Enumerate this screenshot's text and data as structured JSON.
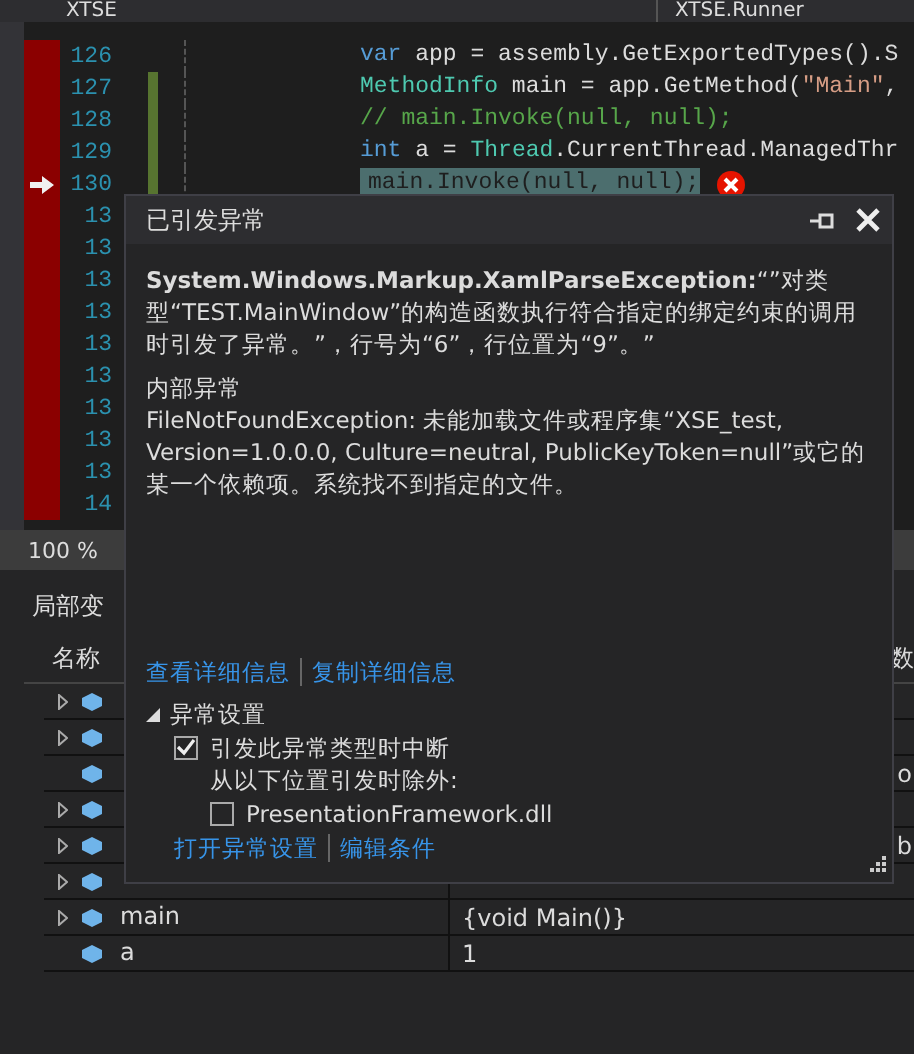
{
  "tabs": [
    {
      "label": "XTSE",
      "kind": "project"
    },
    {
      "label": "XTSE.Runner",
      "kind": "class"
    }
  ],
  "editor": {
    "lines": [
      {
        "number": "126",
        "current": false,
        "error": false,
        "changed": false,
        "tokens": [
          {
            "text": "var",
            "kind": "keyword"
          },
          {
            "text": " app = assembly.GetExportedTypes().S",
            "kind": "plain"
          }
        ]
      },
      {
        "number": "127",
        "current": false,
        "error": false,
        "changed": true,
        "tokens": [
          {
            "text": "MethodInfo",
            "kind": "type"
          },
          {
            "text": " main = app.GetMethod(",
            "kind": "plain"
          },
          {
            "text": "\"Main\"",
            "kind": "string"
          },
          {
            "text": ",",
            "kind": "plain"
          }
        ]
      },
      {
        "number": "128",
        "current": false,
        "error": false,
        "changed": true,
        "tokens": [
          {
            "text": "// main.Invoke(null, null);",
            "kind": "comment"
          }
        ]
      },
      {
        "number": "129",
        "current": false,
        "error": false,
        "changed": true,
        "tokens": [
          {
            "text": "int",
            "kind": "keyword"
          },
          {
            "text": " a = ",
            "kind": "plain"
          },
          {
            "text": "Thread",
            "kind": "type"
          },
          {
            "text": ".CurrentThread.ManagedThr",
            "kind": "plain"
          }
        ]
      },
      {
        "number": "130",
        "current": true,
        "error": true,
        "changed": true,
        "tokens": [
          {
            "text": "main.Invoke(null, null);",
            "kind": "plain"
          }
        ]
      },
      {
        "number": "13"
      },
      {
        "number": "13"
      },
      {
        "number": "13"
      },
      {
        "number": "13"
      },
      {
        "number": "13"
      },
      {
        "number": "13"
      },
      {
        "number": "13"
      },
      {
        "number": "13"
      },
      {
        "number": "13"
      },
      {
        "number": "14"
      }
    ],
    "zoom": "100 %"
  },
  "locals": {
    "title": "局部变",
    "columns": [
      "名称",
      "数"
    ],
    "rows": [
      {
        "expandable": true,
        "name": "",
        "value": ""
      },
      {
        "expandable": true,
        "name": "",
        "value": ""
      },
      {
        "expandable": false,
        "name": "",
        "value": "o"
      },
      {
        "expandable": true,
        "name": "",
        "value": ""
      },
      {
        "expandable": true,
        "name": "",
        "value": "b"
      },
      {
        "expandable": true,
        "name": "",
        "value": ""
      },
      {
        "expandable": true,
        "name": "main",
        "value": "{void Main()}"
      },
      {
        "expandable": false,
        "name": "a",
        "value": "1"
      }
    ]
  },
  "popup": {
    "title": "已引发异常",
    "message": "**System.Windows.Markup.XamlParseException:**“”对类型“TEST.MainWindow”的构造函数执行符合指定的绑定约束的调用时引发了异常。”，行号为“6”，行位置为“9”。”",
    "inner_heading": "内部异常",
    "inner_message": "FileNotFoundException: 未能加载文件或程序集“XSE_test, Version=1.0.0.0, Culture=neutral, PublicKeyToken=null”或它的某一个依赖项。系统找不到指定的文件。",
    "links": [
      "查看详细信息",
      "复制详细信息"
    ],
    "settings": {
      "title": "异常设置",
      "expanded": true,
      "break_label": "引发此异常类型时中断",
      "break_checked": true,
      "except_label": "从以下位置引发时除外:",
      "exceptions": [
        {
          "label": "PresentationFramework.dll",
          "checked": false
        }
      ],
      "links": [
        "打开异常设置",
        "编辑条件"
      ]
    }
  }
}
